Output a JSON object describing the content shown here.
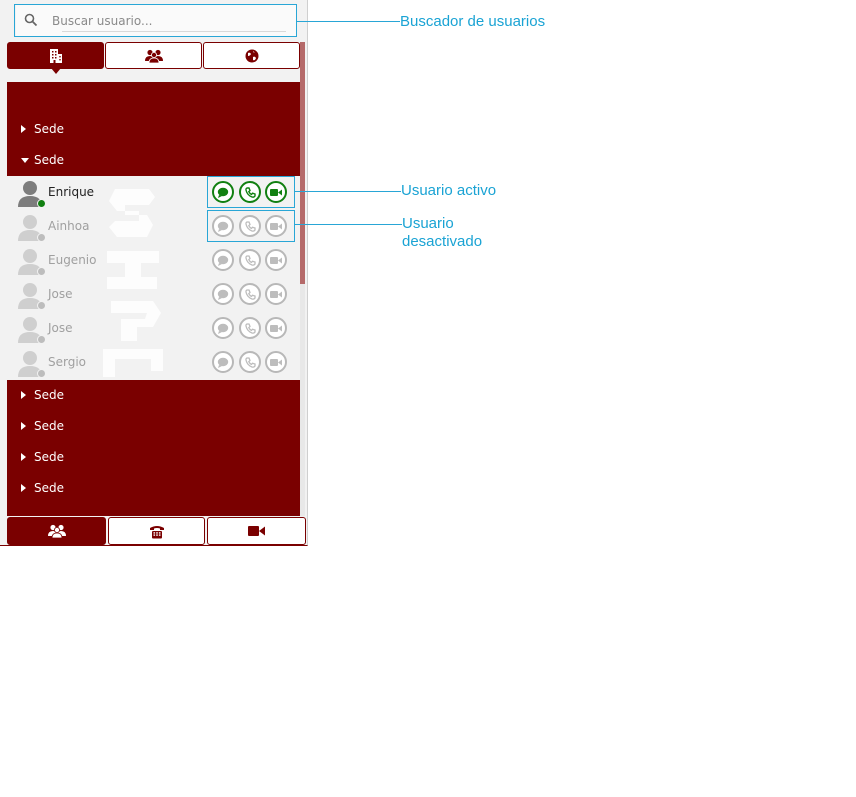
{
  "search": {
    "placeholder": "Buscar usuario..."
  },
  "top_tabs": [
    {
      "icon": "building-icon",
      "active": true
    },
    {
      "icon": "group-icon",
      "active": false
    },
    {
      "icon": "globe-icon",
      "active": false
    }
  ],
  "groups_before": [
    {
      "label": "Sede",
      "expanded": false
    },
    {
      "label": "Sede",
      "expanded": true
    }
  ],
  "users": [
    {
      "name": "Enrique",
      "status": "active"
    },
    {
      "name": "Ainhoa",
      "status": "inactive"
    },
    {
      "name": "Eugenio",
      "status": "inactive"
    },
    {
      "name": "Jose",
      "status": "inactive"
    },
    {
      "name": "Jose",
      "status": "inactive"
    },
    {
      "name": "Sergio",
      "status": "inactive"
    }
  ],
  "groups_after": [
    {
      "label": "Sede",
      "expanded": false
    },
    {
      "label": "Sede",
      "expanded": false
    },
    {
      "label": "Sede",
      "expanded": false
    },
    {
      "label": "Sede",
      "expanded": false
    }
  ],
  "bottom_tabs": [
    {
      "icon": "contacts-icon",
      "active": true
    },
    {
      "icon": "phone-icon",
      "active": false
    },
    {
      "icon": "video-camera-icon",
      "active": false
    }
  ],
  "annotations": {
    "search": "Buscador de usuarios",
    "active_user": "Usuario activo",
    "inactive_user_line1": "Usuario",
    "inactive_user_line2": "desactivado"
  },
  "colors": {
    "brand": "#7a0000",
    "active_green": "#118011",
    "inactive_gray": "#b8b8b8",
    "annotation_blue": "#29a6d6"
  }
}
